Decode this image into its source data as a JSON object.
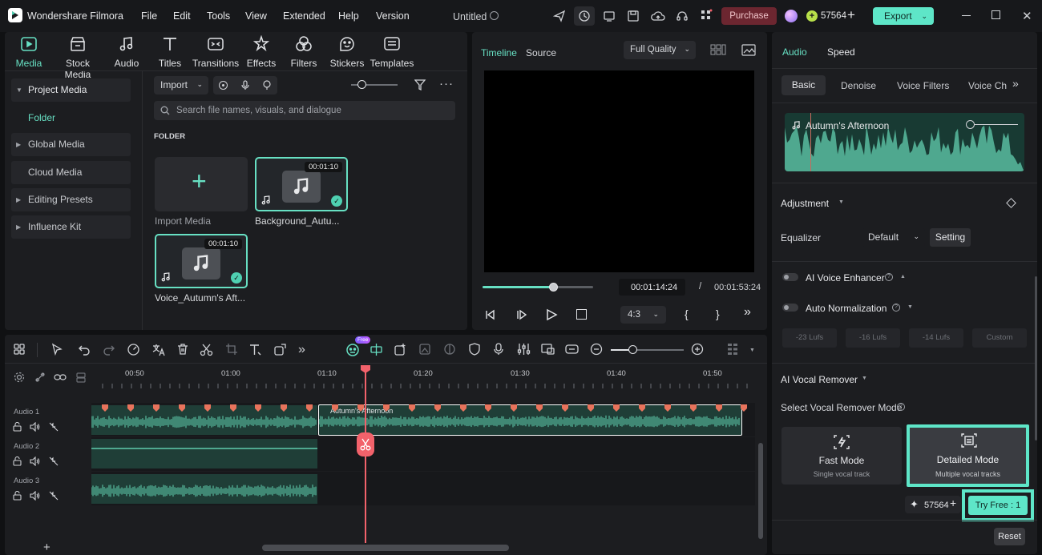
{
  "app": {
    "name": "Wondershare Filmora",
    "project_title": "Untitled"
  },
  "menu": [
    "File",
    "Edit",
    "Tools",
    "View",
    "Extended",
    "Help",
    "Version"
  ],
  "topbar": {
    "purchase": "Purchase",
    "credits": "57564",
    "export": "Export"
  },
  "tools": [
    {
      "label": "Media",
      "icon": "media-icon"
    },
    {
      "label": "Stock Media",
      "icon": "stock-media-icon"
    },
    {
      "label": "Audio",
      "icon": "music-note-icon"
    },
    {
      "label": "Titles",
      "icon": "titles-icon"
    },
    {
      "label": "Transitions",
      "icon": "transitions-icon"
    },
    {
      "label": "Effects",
      "icon": "effects-icon"
    },
    {
      "label": "Filters",
      "icon": "filters-icon"
    },
    {
      "label": "Stickers",
      "icon": "stickers-icon"
    },
    {
      "label": "Templates",
      "icon": "templates-icon"
    }
  ],
  "sidebar": {
    "items": [
      "Project Media",
      "Folder",
      "Global Media",
      "Cloud Media",
      "Editing Presets",
      "Influence Kit"
    ]
  },
  "media": {
    "import_label": "Import",
    "search_placeholder": "Search file names, visuals, and dialogue",
    "folder_heading": "FOLDER",
    "import_media": "Import Media",
    "items": [
      {
        "name": "Background_Autu...",
        "duration": "00:01:10"
      },
      {
        "name": "Voice_Autumn's Aft...",
        "duration": "00:01:10"
      }
    ]
  },
  "player": {
    "tab_timeline": "Timeline",
    "tab_source": "Source",
    "quality": "Full Quality",
    "current_time": "00:01:14:24",
    "separator": "/",
    "total_time": "00:01:53:24",
    "aspect": "4:3",
    "progress": 0.64
  },
  "timeline": {
    "ruler": [
      "00:50",
      "01:00",
      "01:10",
      "01:20",
      "01:30",
      "01:40",
      "01:50"
    ],
    "tracks": [
      "Audio 1",
      "Audio 2",
      "Audio 3"
    ],
    "clip_name": "Autumn's Afternoon",
    "free_badge": "Free",
    "zoom": 0.3
  },
  "right_panel": {
    "tabs": [
      "Audio",
      "Speed"
    ],
    "subtabs": [
      "Basic",
      "Denoise",
      "Voice Filters",
      "Voice Cha"
    ],
    "waveform_title": "Autumn's Afternoon",
    "adjustment": "Adjustment",
    "equalizer_label": "Equalizer",
    "equalizer_value": "Default",
    "setting": "Setting",
    "ai_voice_enhancer": "AI Voice Enhancer",
    "auto_normalization": "Auto Normalization",
    "lufs": [
      "-23 Lufs",
      "-16 Lufs",
      "-14 Lufs",
      "Custom"
    ],
    "ai_vocal_remover": "AI Vocal Remover",
    "select_mode": "Select Vocal Remover Mode",
    "fast_mode": {
      "title": "Fast Mode",
      "desc": "Single vocal track"
    },
    "detailed_mode": {
      "title": "Detailed Mode",
      "desc": "Multiple vocal tracks"
    },
    "credits": "57564",
    "try_free": "Try Free : 1",
    "reset": "Reset"
  },
  "colors": {
    "accent": "#67e0c3",
    "playhead": "#f2626b",
    "audio_wave": "#4fa88f",
    "purchase": "#7a2a33"
  }
}
